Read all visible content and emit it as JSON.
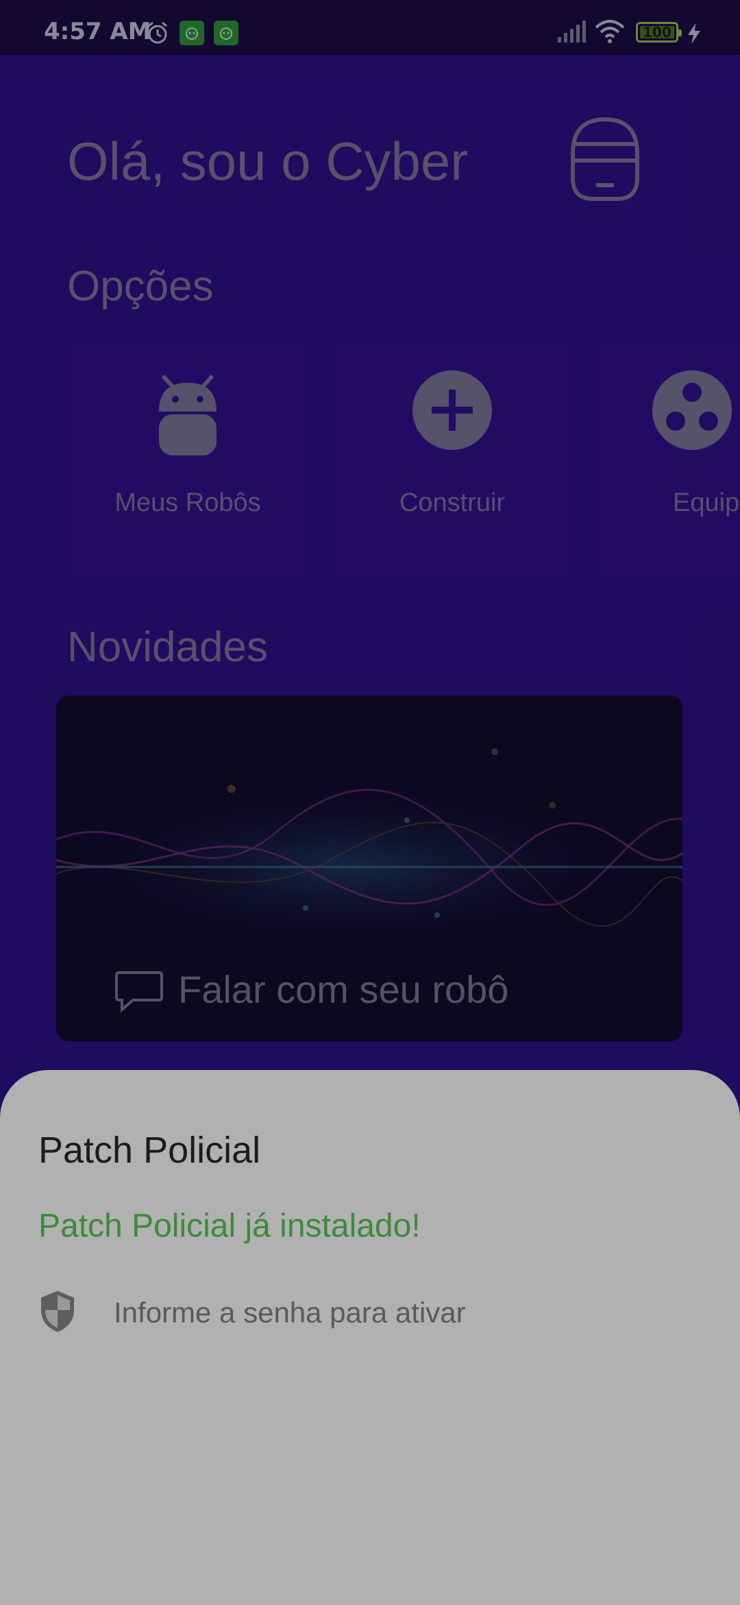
{
  "status_bar": {
    "time": "4:57 AM",
    "battery_level": "100",
    "icons": [
      "alarm-icon",
      "app-notification-icon",
      "app-notification-icon",
      "signal-icon",
      "wifi-icon",
      "battery-icon",
      "charging-icon"
    ]
  },
  "home": {
    "greeting": "Olá, sou o Cyber",
    "options_title": "Opções",
    "options": [
      {
        "label": "Meus Robôs",
        "icon": "android-robot-icon"
      },
      {
        "label": "Construir",
        "icon": "add-circle-icon"
      },
      {
        "label": "Equip",
        "icon": "group-icon"
      }
    ],
    "news_title": "Novidades",
    "banner": {
      "label": "Falar com seu robô",
      "icon": "chat-bubble-icon"
    }
  },
  "sheet": {
    "title": "Patch Policial",
    "status": "Patch Policial já instalado!",
    "action_label": "Informe a senha para ativar",
    "action_icon": "shield-icon"
  },
  "colors": {
    "app_bg": "#2b0f85",
    "card_bg": "#30108a",
    "sheet_bg": "#b1b1b1",
    "success": "#3d8a3a"
  }
}
